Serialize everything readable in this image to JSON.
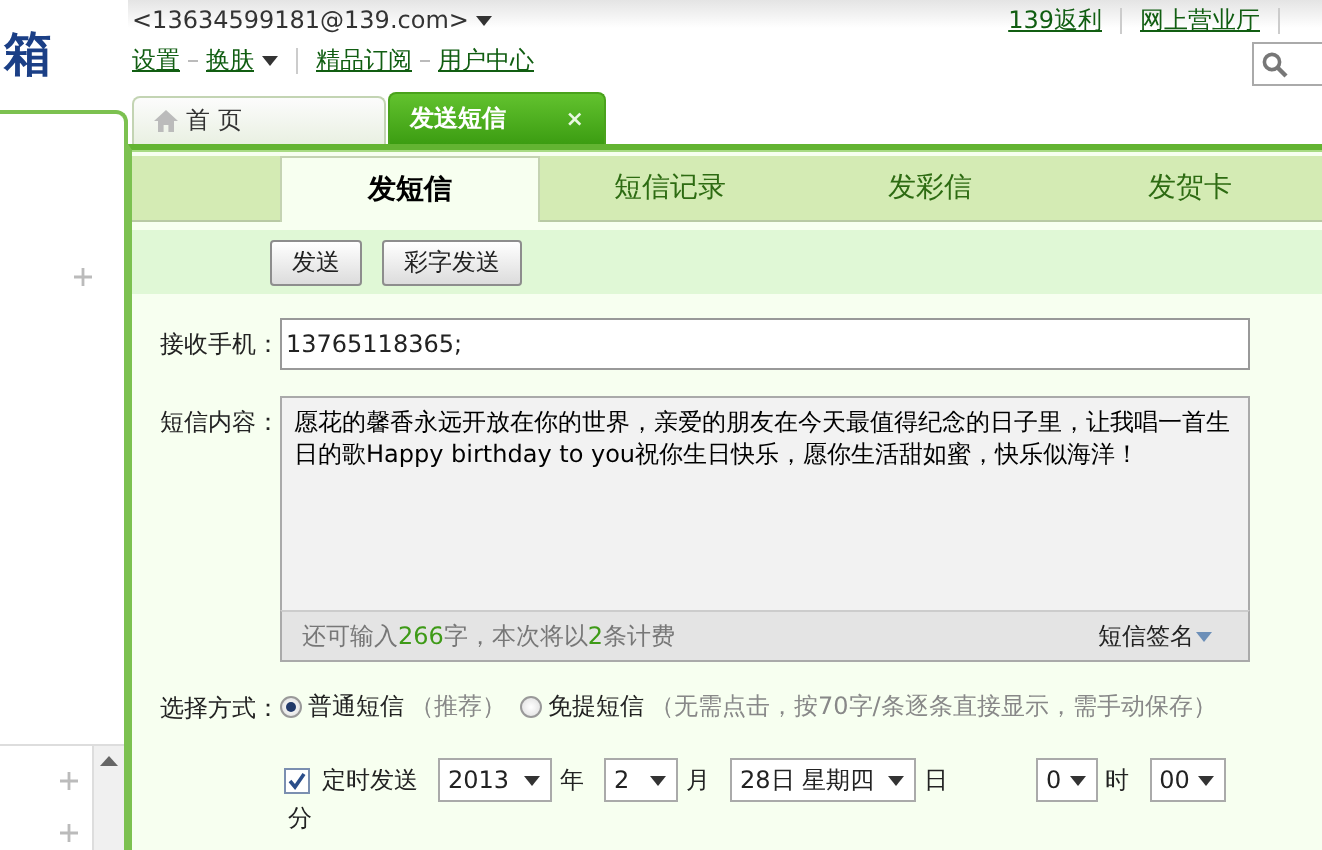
{
  "logo": {
    "text": "箱"
  },
  "account": {
    "email": "<13634599181@139.com>",
    "dropdown": true
  },
  "top_links": [
    "139返利",
    "网上营业厅"
  ],
  "header_links": [
    {
      "label": "设置",
      "dropdown": false
    },
    {
      "label": "换肤",
      "dropdown": true
    },
    {
      "label": "精品订阅",
      "dropdown": false
    },
    {
      "label": "用户中心",
      "dropdown": false
    }
  ],
  "tabs": [
    {
      "label": "首 页",
      "selected": false
    },
    {
      "label": "发送短信",
      "selected": true,
      "close": "×"
    }
  ],
  "compose_tabs": [
    {
      "label": "发短信",
      "selected": true
    },
    {
      "label": "短信记录",
      "selected": false
    },
    {
      "label": "发彩信",
      "selected": false
    },
    {
      "label": "发贺卡",
      "selected": false
    }
  ],
  "toolbar": {
    "buttons": [
      "发送",
      "彩字发送"
    ]
  },
  "recipient": {
    "label": "接收手机：",
    "value": "13765118365;"
  },
  "message": {
    "label": "短信内容：",
    "text": "愿花的馨香永远开放在你的世界，亲爱的朋友在今天最值得纪念的日子里，让我唱一首生日的歌Happy birthday to you祝你生日快乐，愿你生活甜如蜜，快乐似海洋！",
    "counter": [
      {
        "text": "还可输入",
        "highlight": false
      },
      {
        "text": "266",
        "highlight": true
      },
      {
        "text": "字，本次将以",
        "highlight": false
      },
      {
        "text": "2",
        "highlight": true
      },
      {
        "text": "条计费",
        "highlight": false
      }
    ],
    "signature": "短信签名"
  },
  "sending_mode": {
    "label": "选择方式：",
    "options": [
      {
        "label": "普通短信",
        "note": "（推荐）",
        "selected": true
      },
      {
        "label": "免提短信",
        "note": "（无需点击，按70字/条逐条直接显示，需手动保存）",
        "selected": false
      }
    ]
  },
  "schedule": {
    "label": "定时发送",
    "checked": true,
    "fields": [
      {
        "value": "2013",
        "unit": "年"
      },
      {
        "value": "2",
        "unit": "月"
      },
      {
        "value": "28日 星期四",
        "unit": "日"
      },
      {
        "value": "0",
        "unit": "时"
      },
      {
        "value": "00",
        "unit": "分"
      }
    ]
  }
}
